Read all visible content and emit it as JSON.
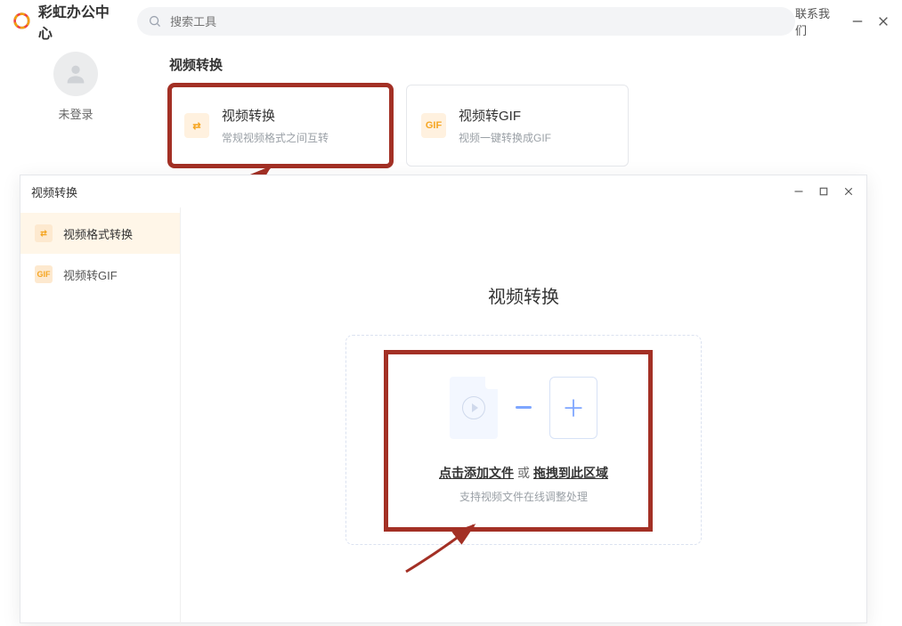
{
  "app": {
    "title": "彩虹办公中心",
    "search_placeholder": "搜索工具",
    "contact_label": "联系我们",
    "login_status": "未登录"
  },
  "section": {
    "title": "视频转换",
    "cards": [
      {
        "title": "视频转换",
        "desc": "常规视频格式之间互转",
        "icon_label": "⇄"
      },
      {
        "title": "视频转GIF",
        "desc": "视频一键转换成GIF",
        "icon_label": "GIF"
      }
    ]
  },
  "inner": {
    "title": "视频转换",
    "sidebar": [
      {
        "label": "视频格式转换",
        "icon": "⇄"
      },
      {
        "label": "视频转GIF",
        "icon": "GIF"
      }
    ],
    "heading": "视频转换",
    "drop": {
      "click_text": "点击添加文件",
      "or_text": "或",
      "drag_text": "拖拽到此区域",
      "sub_text": "支持视频文件在线调整处理"
    }
  }
}
